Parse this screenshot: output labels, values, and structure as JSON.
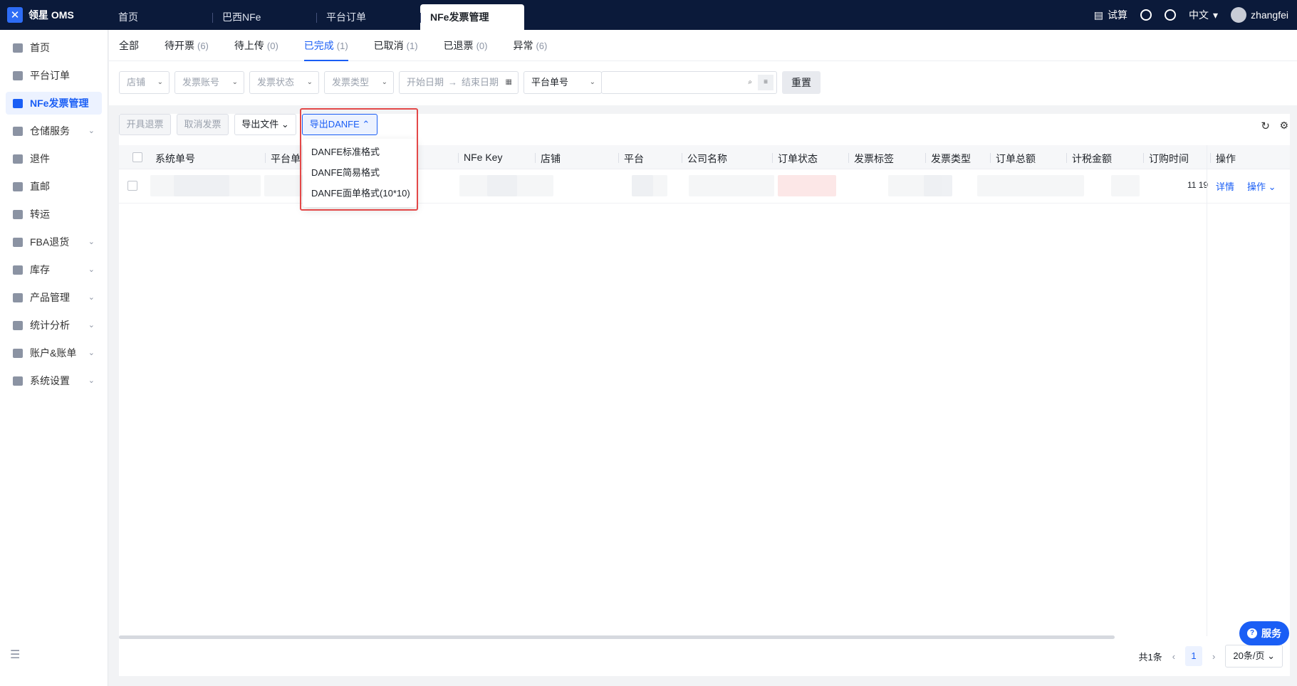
{
  "app": {
    "brand": "领星 OMS"
  },
  "top_tabs": [
    {
      "label": "首页"
    },
    {
      "label": "巴西NFe"
    },
    {
      "label": "平台订单"
    },
    {
      "label": "NFe发票管理"
    }
  ],
  "top_right": {
    "calc": "试算",
    "lang": "中文",
    "user": "zhangfei"
  },
  "sidebar": {
    "items": [
      {
        "label": "首页"
      },
      {
        "label": "平台订单"
      },
      {
        "label": "NFe发票管理"
      },
      {
        "label": "仓储服务"
      },
      {
        "label": "退件"
      },
      {
        "label": "直邮"
      },
      {
        "label": "转运"
      },
      {
        "label": "FBA退货"
      },
      {
        "label": "库存"
      },
      {
        "label": "产品管理"
      },
      {
        "label": "统计分析"
      },
      {
        "label": "账户&账单"
      },
      {
        "label": "系统设置"
      }
    ]
  },
  "status_tabs": [
    {
      "label": "全部",
      "count": ""
    },
    {
      "label": "待开票",
      "count": "(6)"
    },
    {
      "label": "待上传",
      "count": "(0)"
    },
    {
      "label": "已完成",
      "count": "(1)"
    },
    {
      "label": "已取消",
      "count": "(1)"
    },
    {
      "label": "已退票",
      "count": "(0)"
    },
    {
      "label": "异常",
      "count": "(6)"
    }
  ],
  "filters": {
    "store": "店铺",
    "invoice_account": "发票账号",
    "invoice_status": "发票状态",
    "invoice_type": "发票类型",
    "start_date": "开始日期",
    "end_date": "结束日期",
    "platform_no": "平台单号",
    "reset": "重置"
  },
  "actions": {
    "refund_invoice": "开具退票",
    "cancel_invoice": "取消发票",
    "export_file": "导出文件",
    "export_danfe": "导出DANFE"
  },
  "danfe_menu": [
    {
      "label": "DANFE标准格式"
    },
    {
      "label": "DANFE简易格式"
    },
    {
      "label": "DANFE面单格式(10*10)"
    }
  ],
  "columns": [
    "系统单号",
    "平台单",
    "NFe Key",
    "店铺",
    "平台",
    "公司名称",
    "订单状态",
    "发票标签",
    "发票类型",
    "订单总额",
    "计税金额",
    "订购时间",
    "操作"
  ],
  "row": {
    "time_fragment": "11 19",
    "detail": "详情",
    "ops": "操作"
  },
  "pager": {
    "total": "共1条",
    "page": "1",
    "page_size": "20条/页"
  },
  "service": "服务"
}
